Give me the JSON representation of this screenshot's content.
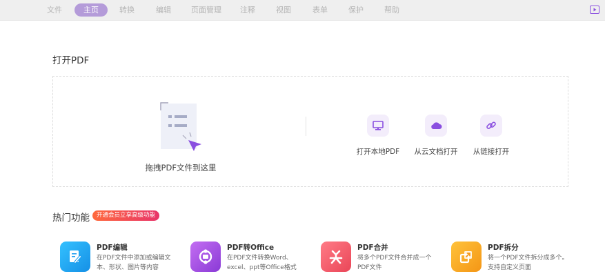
{
  "menu": {
    "items": [
      "文件",
      "主页",
      "转换",
      "编辑",
      "页面管理",
      "注释",
      "视图",
      "表单",
      "保护",
      "帮助"
    ],
    "active": "主页"
  },
  "open_section": {
    "title": "打开PDF",
    "drop_label": "拖拽PDF文件到这里",
    "options": [
      {
        "label": "打开本地PDF",
        "icon": "monitor-icon"
      },
      {
        "label": "从云文档打开",
        "icon": "cloud-icon"
      },
      {
        "label": "从链接打开",
        "icon": "link-icon"
      }
    ]
  },
  "features_section": {
    "title": "热门功能",
    "badge": "开通会员立享高级功能",
    "items": [
      {
        "name": "PDF编辑",
        "desc": "在PDF文件中添加或编辑文本、形状、图片等内容",
        "icon": "edit-icon",
        "color": "#1fa6f0"
      },
      {
        "name": "PDF转Office",
        "desc": "在PDF文件转换Word、excel、ppt等Office格式",
        "icon": "convert-icon",
        "color": "#a34ee0"
      },
      {
        "name": "PDF合并",
        "desc": "将多个PDF文件合并成一个PDF文件",
        "icon": "merge-icon",
        "color": "#f0596a"
      },
      {
        "name": "PDF拆分",
        "desc": "将一个PDF文件拆分成多个。支持自定义页面",
        "icon": "split-icon",
        "color": "#f6a41f"
      }
    ]
  },
  "colors": {
    "accent": "#8a4fe0",
    "active_tab": "#b49bd9",
    "badge": "#e8346a"
  }
}
